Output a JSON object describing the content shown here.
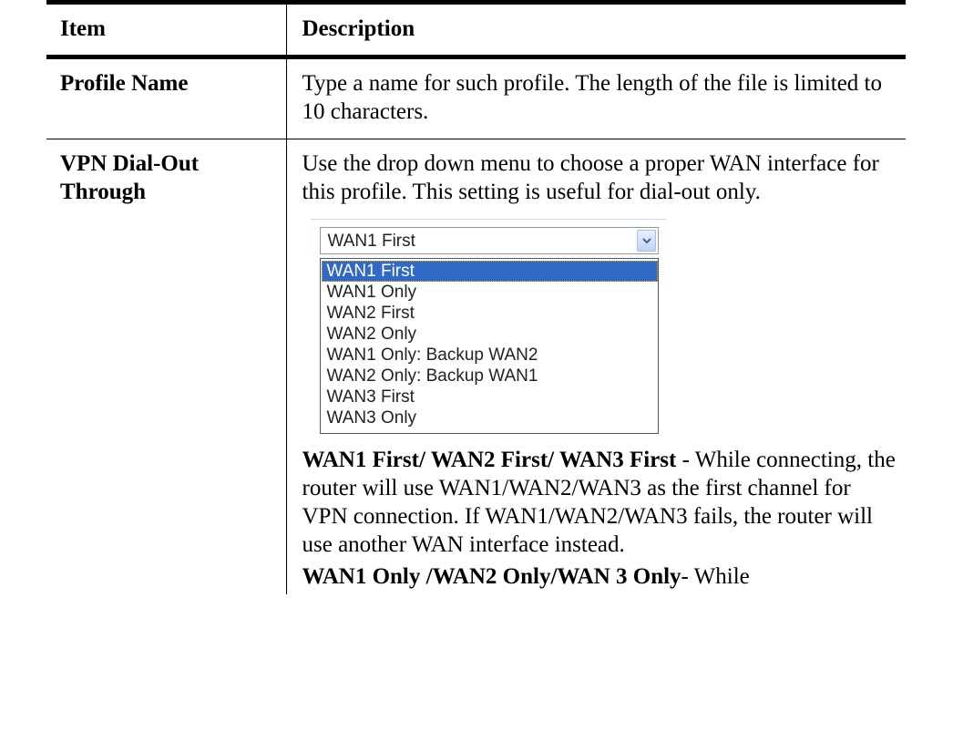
{
  "table": {
    "header": {
      "item": "Item",
      "description": "Description"
    },
    "rows": [
      {
        "item": "Profile Name",
        "description": "Type a name for such profile. The length of the file is limited to 10 characters."
      },
      {
        "item": "VPN Dial-Out Through",
        "description": "Use the drop down menu to choose a proper WAN interface for this profile. This setting is useful for dial-out only."
      }
    ]
  },
  "dropdown": {
    "selected": "WAN1 First",
    "options": [
      "WAN1 First",
      "WAN1 Only",
      "WAN2 First",
      "WAN2 Only",
      "WAN1 Only: Backup WAN2",
      "WAN2 Only: Backup WAN1",
      "WAN3 First",
      "WAN3 Only"
    ],
    "highlight_color": "#3169c6"
  },
  "notes": [
    {
      "term": "WAN1 First/ WAN2 First/ WAN3 First",
      "text": " - While connecting, the router will use WAN1/WAN2/WAN3 as the first channel for VPN connection. If WAN1/WAN2/WAN3 fails, the router will use another WAN interface instead."
    },
    {
      "term": "WAN1 Only /WAN2 Only/WAN 3 Only",
      "text": "- While"
    }
  ]
}
